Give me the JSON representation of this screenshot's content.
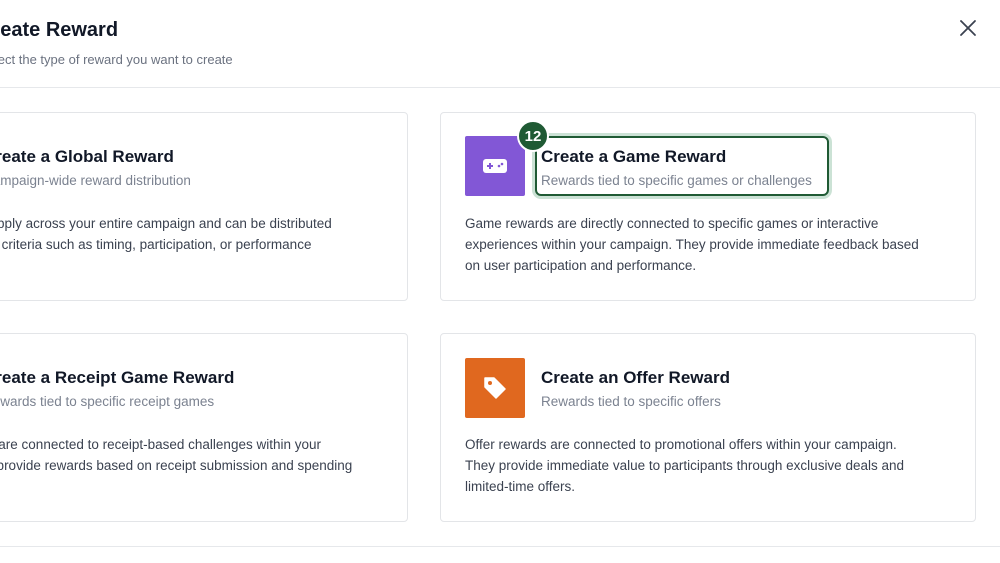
{
  "modal": {
    "title": "Create Reward",
    "subtitle": "Select the type of reward you want to create"
  },
  "cards": {
    "global": {
      "title": "Create a Global Reward",
      "subtitle": "Campaign-wide reward distribution",
      "desc_line1": "Global rewards apply across your entire campaign and can be distributed",
      "desc_line2": "based on various criteria such as timing, participation, or performance"
    },
    "game": {
      "title": "Create a Game Reward",
      "subtitle": "Rewards tied to specific games or challenges",
      "desc_line1": "Game rewards are directly connected to specific games or interactive",
      "desc_line2": "experiences within your campaign. They provide immediate feedback based",
      "desc_line3": "on user participation and performance.",
      "icon": "gamepad-icon",
      "icon_color": "#8257d6"
    },
    "receipt": {
      "title": "Create a Receipt Game Reward",
      "subtitle": "Rewards tied to specific receipt games",
      "desc_line1": "Receipt rewards are connected to receipt-based challenges within your",
      "desc_line2": "campaign. They provide rewards based on receipt submission and spending"
    },
    "offer": {
      "title": "Create an Offer Reward",
      "subtitle": "Rewards tied to specific offers",
      "desc_line1": "Offer rewards are connected to promotional offers within your campaign.",
      "desc_line2": "They provide immediate value to participants through exclusive deals and",
      "desc_line3": "limited-time offers.",
      "icon": "tag-icon",
      "icon_color": "#e0681f"
    }
  },
  "annotation": {
    "step_number": "12",
    "highlight_color": "#1f5a34"
  }
}
